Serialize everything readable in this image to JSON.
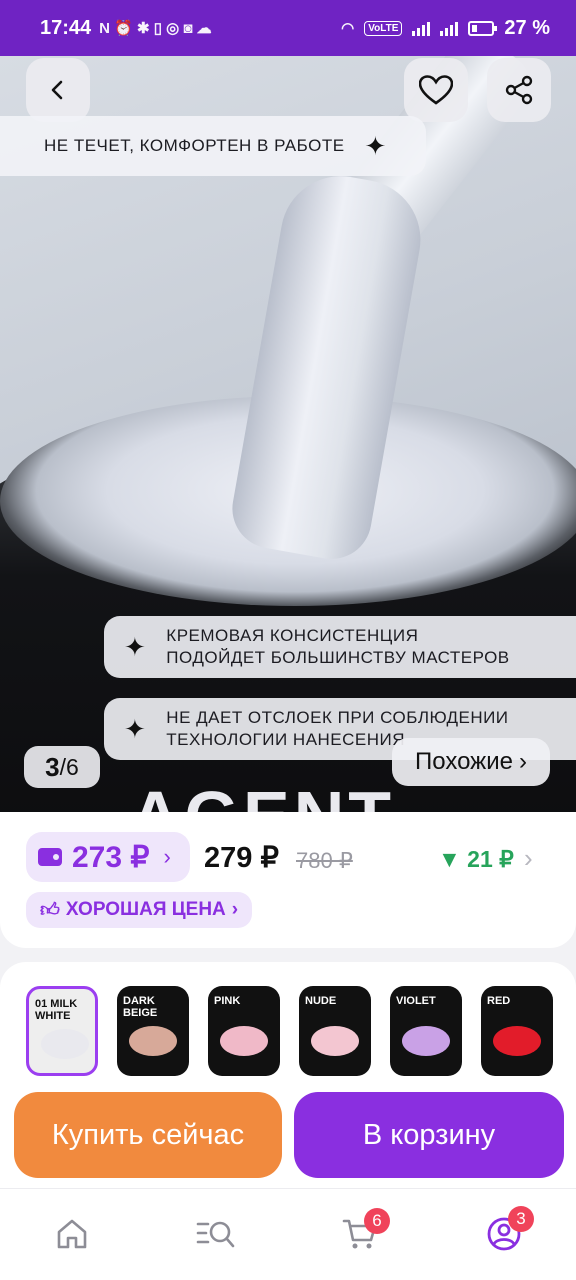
{
  "status_bar": {
    "time": "17:44",
    "volte": "VoLTE",
    "battery": "27 %"
  },
  "hero": {
    "feature_1": "НЕ ТЕЧЕТ, КОМФОРТЕН В РАБОТЕ",
    "feature_2_line1": "КРЕМОВАЯ КОНСИСТЕНЦИЯ",
    "feature_2_line2": "ПОДОЙДЕТ БОЛЬШИНСТВУ МАСТЕРОВ",
    "feature_3_line1": "НЕ ДАЕТ ОТСЛОЕК ПРИ СОБЛЮДЕНИИ",
    "feature_3_line2": "ТЕХНОЛОГИИ НАНЕСЕНИЯ",
    "image_current": "3",
    "image_total": "6",
    "similar_label": "Похожие",
    "brand_text": "AGENT"
  },
  "price": {
    "wallet_price": "273 ₽",
    "regular_price": "279 ₽",
    "old_price": "780 ₽",
    "drop": "21 ₽",
    "good_price_label": "ХОРОШАЯ ЦЕНА"
  },
  "variants": [
    {
      "label": "01 MILK WHITE",
      "color": "#e9e9ee",
      "selected": true
    },
    {
      "label": "DARK BEIGE",
      "color": "#d7a999"
    },
    {
      "label": "PINK",
      "color": "#f0b9c8"
    },
    {
      "label": "NUDE",
      "color": "#f3c6d1"
    },
    {
      "label": "VIOLET",
      "color": "#c9a1e6"
    },
    {
      "label": "RED",
      "color": "#e21c2a"
    }
  ],
  "actions": {
    "buy_now": "Купить сейчас",
    "add_to_cart": "В корзину"
  },
  "tabbar": {
    "cart_badge": "6",
    "profile_badge": "3"
  },
  "colors": {
    "accent": "#8a2fe0",
    "buy": "#f18a3e",
    "status_bar": "#6f23c3",
    "drop": "#27a45b"
  }
}
